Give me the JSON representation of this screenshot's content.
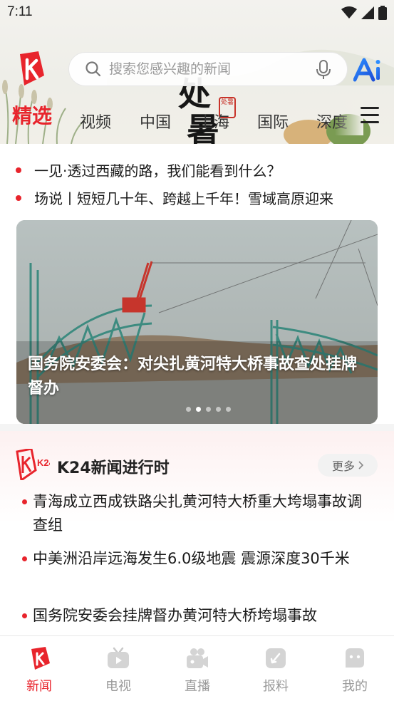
{
  "status_bar": {
    "time": "7:11"
  },
  "search": {
    "placeholder": "搜索您感兴趣的新闻"
  },
  "header_art": {
    "brush_chars": [
      "处",
      "暑"
    ],
    "seal_text": "处暑"
  },
  "tabs": [
    {
      "label": "精选",
      "active": true
    },
    {
      "label": "视频"
    },
    {
      "label": "中国"
    },
    {
      "label": "上海"
    },
    {
      "label": "国际"
    },
    {
      "label": "深度"
    }
  ],
  "headlines": [
    "一见·透过西藏的路，我们能看到什么？",
    "场说丨短短几十年、跨越上千年！雪域高原迎来"
  ],
  "banner": {
    "title": "国务院安委会：对尖扎黄河特大桥事故查处挂牌督办",
    "page_count": 5,
    "active_page": 2
  },
  "k24": {
    "logo_text": "K24",
    "title": "K24新闻进行时",
    "more_label": "更多",
    "items": [
      "青海成立西成铁路尖扎黄河特大桥重大垮塌事故调查组",
      "中美洲沿岸远海发生6.0级地震 震源深度30千米",
      "国务院安委会挂牌督办黄河特大桥垮塌事故"
    ]
  },
  "bottom_nav": [
    {
      "label": "新闻",
      "icon": "news-icon",
      "active": true
    },
    {
      "label": "电视",
      "icon": "tv-icon"
    },
    {
      "label": "直播",
      "icon": "live-camera-icon"
    },
    {
      "label": "报料",
      "icon": "report-icon"
    },
    {
      "label": "我的",
      "icon": "profile-icon"
    }
  ],
  "colors": {
    "accent": "#e8242c"
  }
}
